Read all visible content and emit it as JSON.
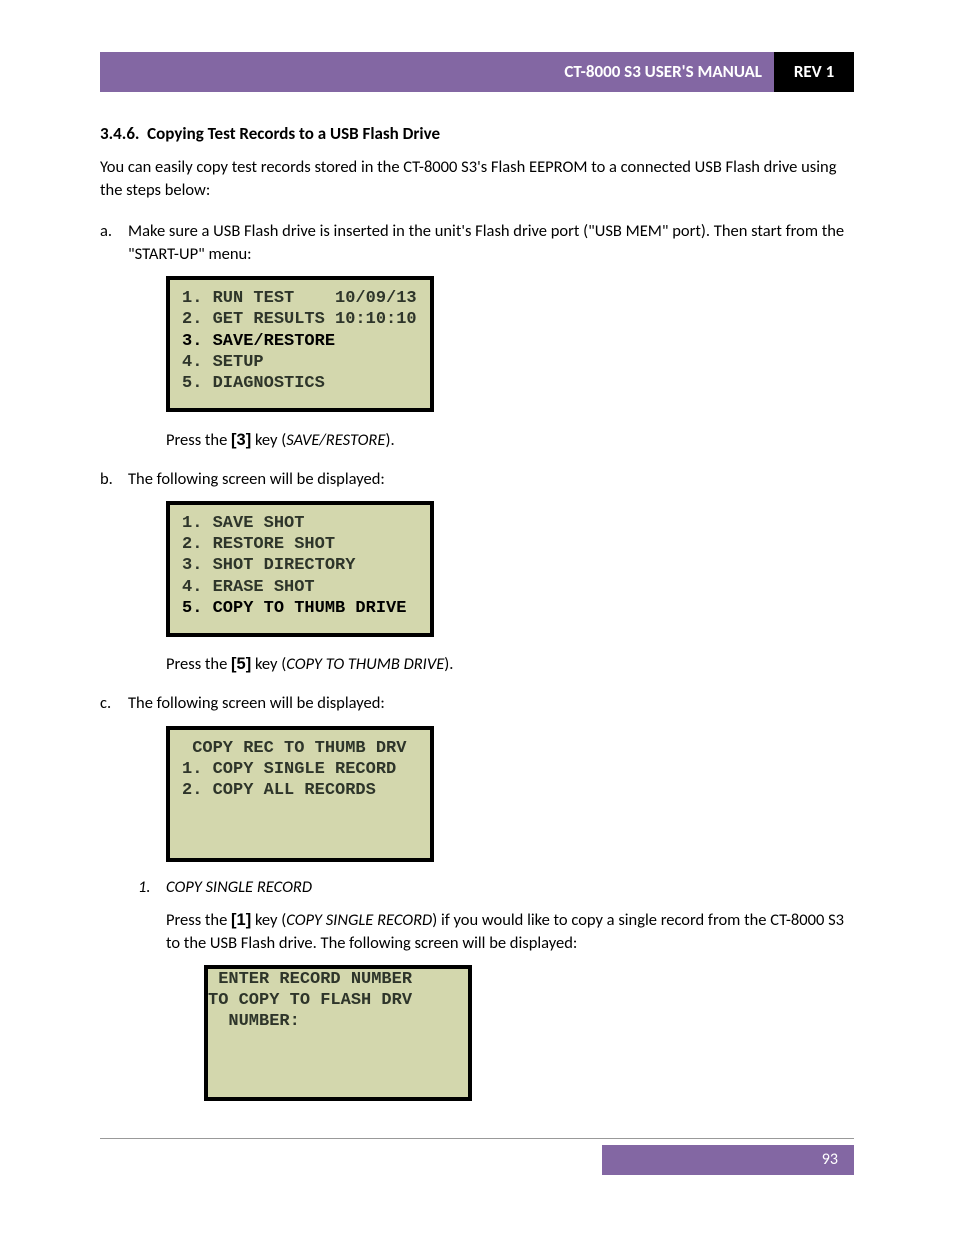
{
  "header": {
    "title": "CT-8000 S3 USER'S MANUAL",
    "rev": "REV 1"
  },
  "section": {
    "number": "3.4.6.",
    "title": "Copying Test Records to a USB Flash Drive"
  },
  "intro": "You can easily copy test records stored in the CT-8000 S3's Flash EEPROM to a connected USB Flash drive using the steps below:",
  "steps": {
    "a": {
      "marker": "a.",
      "text": "Make sure a USB Flash drive is inserted in the unit's Flash drive port (\"USB MEM\" port). Then start from the \"START-UP\" menu:",
      "lcd": [
        {
          "t": "1. RUN TEST    10/09/13",
          "b": false
        },
        {
          "t": "2. GET RESULTS 10:10:10",
          "b": false
        },
        {
          "t": "3. SAVE/RESTORE",
          "b": true
        },
        {
          "t": "4. SETUP",
          "b": false
        },
        {
          "t": "5. DIAGNOSTICS",
          "b": false
        }
      ],
      "after_pre": "Press the ",
      "after_key": "[3]",
      "after_mid": " key (",
      "after_ital": "SAVE/RESTORE",
      "after_post": ")."
    },
    "b": {
      "marker": "b.",
      "text": "The following screen will be displayed:",
      "lcd": [
        {
          "t": "1. SAVE SHOT",
          "b": false
        },
        {
          "t": "2. RESTORE SHOT",
          "b": false
        },
        {
          "t": "3. SHOT DIRECTORY",
          "b": false
        },
        {
          "t": "4. ERASE SHOT",
          "b": false
        },
        {
          "t": "5. COPY TO THUMB DRIVE",
          "b": true
        }
      ],
      "after_pre": "Press the ",
      "after_key": "[5]",
      "after_mid": " key (",
      "after_ital": "COPY TO THUMB DRIVE",
      "after_post": ")."
    },
    "c": {
      "marker": "c.",
      "text": "The following screen will be displayed:",
      "lcd": [
        {
          "t": " COPY REC TO THUMB DRV",
          "b": false
        },
        {
          "t": "",
          "b": false
        },
        {
          "t": "1. COPY SINGLE RECORD",
          "b": false
        },
        {
          "t": "2. COPY ALL RECORDS",
          "b": false
        }
      ],
      "sub": {
        "marker": "1.",
        "title": "COPY SINGLE RECORD",
        "para_pre": "Press the ",
        "para_key": "[1]",
        "para_mid": " key (",
        "para_ital": "COPY SINGLE RECORD",
        "para_post": ") if you would like to copy a single record from the CT-8000 S3 to the USB Flash drive. The following screen will be displayed:",
        "lcd": [
          {
            "t": " ENTER RECORD NUMBER",
            "b": false
          },
          {
            "t": "TO COPY TO FLASH DRV",
            "b": false
          },
          {
            "t": "",
            "b": false
          },
          {
            "t": "  NUMBER:",
            "b": false
          }
        ]
      }
    }
  },
  "page_number": "93"
}
